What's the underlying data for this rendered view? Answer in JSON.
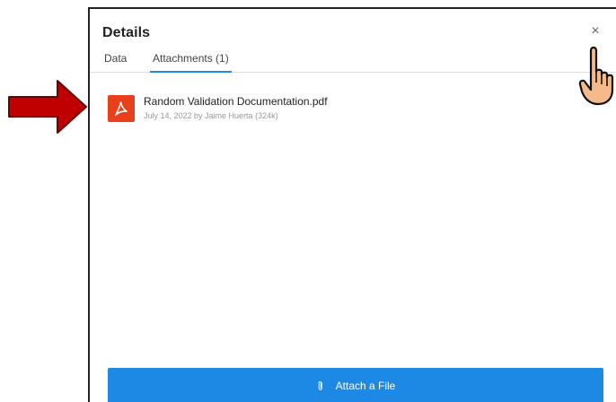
{
  "panel": {
    "title": "Details",
    "close_glyph": "×"
  },
  "tabs": [
    {
      "label": "Data",
      "active": false
    },
    {
      "label": "Attachments (1)",
      "active": true
    }
  ],
  "attachments": [
    {
      "icon": "pdf-icon",
      "file_name": "Random Validation Documentation.pdf",
      "meta": "July 14, 2022 by Jaime Huerta (324k)"
    }
  ],
  "footer": {
    "attach_label": "Attach a File",
    "attach_icon": "paperclip-icon"
  },
  "colors": {
    "accent": "#1e88e5",
    "pdf_red": "#e8401c",
    "annotation_arrow": "#c00000",
    "pointer_hand": "#f5b98a"
  }
}
